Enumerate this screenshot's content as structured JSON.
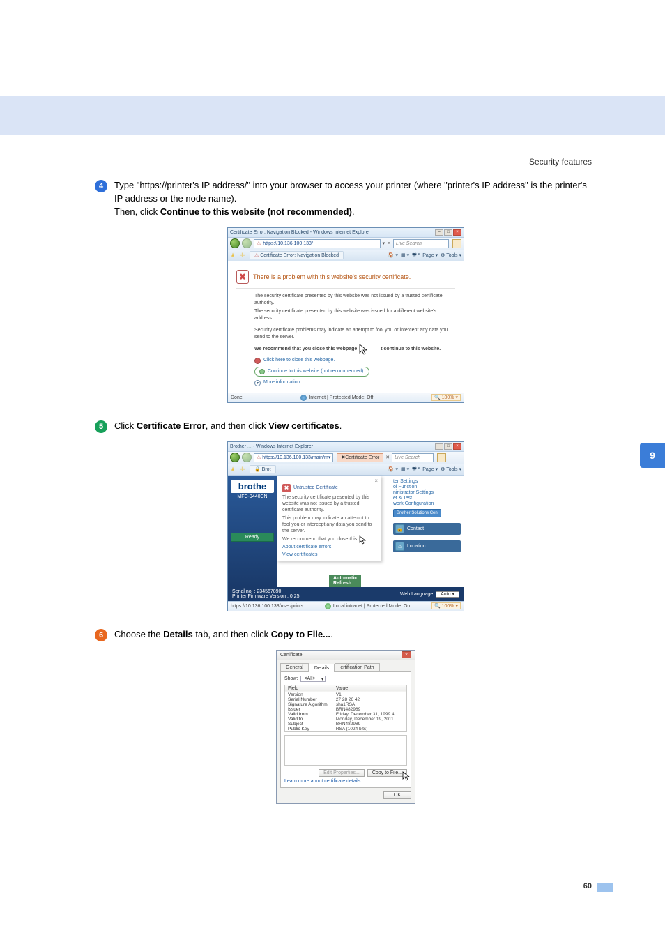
{
  "header": {
    "section": "Security features"
  },
  "side_tab": "9",
  "page_number": "60",
  "steps": {
    "s4": {
      "num": "4",
      "line1_a": "Type \"https://printer's IP address/\" into your browser to access your printer (where \"printer's IP address\" is the printer's IP address or the node name).",
      "line2_a": "Then, click ",
      "line2_b": "Continue to this website (not recommended)",
      "line2_c": "."
    },
    "s5": {
      "num": "5",
      "a": "Click ",
      "b": "Certificate Error",
      "c": ", and then click ",
      "d": "View certificates",
      "e": "."
    },
    "s6": {
      "num": "6",
      "a": "Choose the ",
      "b": "Details",
      "c": " tab, and then click ",
      "d": "Copy to File...",
      "e": "."
    }
  },
  "fig1": {
    "title": "Certificate Error: Navigation Blocked - Windows Internet Explorer",
    "url": "https://10.136.100.133/",
    "search_placeholder": "Live Search",
    "tab": "Certificate Error: Navigation Blocked",
    "tb_page": "Page",
    "tb_tools": "Tools",
    "heading": "There is a problem with this website's security certificate.",
    "p1": "The security certificate presented by this website was not issued by a trusted certificate authority.",
    "p2": "The security certificate presented by this website was issued for a different website's address.",
    "p3": "Security certificate problems may indicate an attempt to fool you or intercept any data you send to the server.",
    "rec_a": "We recommend that you close this webpage ",
    "rec_b": "t continue to this website.",
    "link_close": "Click here to close this webpage.",
    "link_continue": "Continue to this website (not recommended).",
    "more": "More information",
    "status_left": "Done",
    "status_mid": "Internet | Protected Mode: Off",
    "zoom": "100%"
  },
  "fig2": {
    "title_a": "Brother",
    "title_b": "Windows Internet Explorer",
    "url": "https://10.136.100.133/main/m",
    "cert_err": "Certificate Error",
    "search_placeholder": "Live Search",
    "tab": "Brot",
    "tb_page": "Page",
    "tb_tools": "Tools",
    "brand": "brothe",
    "model": "MFC-9440CN",
    "ready": "Ready",
    "popup_title": "Untrusted Certificate",
    "popup_p1": "The security certificate presented by this website was not issued by a trusted certificate authority.",
    "popup_p2": "This problem may indicate an attempt to fool you or intercept any data you send to the server.",
    "popup_rec": "We recommend that you close this",
    "popup_about": "About certificate errors",
    "popup_view": "View certificates",
    "rlinks": {
      "a": "ter Settings",
      "b": "ol Function",
      "c": "ninistrator Settings",
      "d": "et & Test",
      "e": "work Configuration"
    },
    "bsol": "Brother Solutions Cen",
    "contact": "Contact",
    "location": "Location",
    "auto_refresh_a": "Automatic",
    "auto_refresh_b": "Refresh",
    "serial": "Serial no. : 234567890",
    "firmware": "Printer Firmware Version : 0.25",
    "weblang_label": "Web Language:",
    "weblang_val": "Auto",
    "status_url": "https://10.136.100.133/user/prints",
    "status_mid": "Local intranet | Protected Mode: On",
    "zoom": "100%"
  },
  "fig3": {
    "title": "Certificate",
    "tabs": {
      "general": "General",
      "details": "Details",
      "path": "ertification Path"
    },
    "show_label": "Show:",
    "show_val": "<All>",
    "th_field": "Field",
    "th_value": "Value",
    "rows": [
      {
        "f": "Version",
        "v": "V1"
      },
      {
        "f": "Serial Number",
        "v": "27 28 26 42"
      },
      {
        "f": "Signature Algorithm",
        "v": "sha1RSA"
      },
      {
        "f": "Issuer",
        "v": "BRN482989"
      },
      {
        "f": "Valid from",
        "v": "Friday, December 31, 1999 4:..."
      },
      {
        "f": "Valid to",
        "v": "Monday, December 19, 2011 ..."
      },
      {
        "f": "Subject",
        "v": "BRN482989"
      },
      {
        "f": "Public Key",
        "v": "RSA (1024 bits)"
      }
    ],
    "btn_edit": "Edit Properties...",
    "btn_copy": "Copy to File...",
    "learn": "Learn more about certificate details",
    "ok": "OK"
  }
}
